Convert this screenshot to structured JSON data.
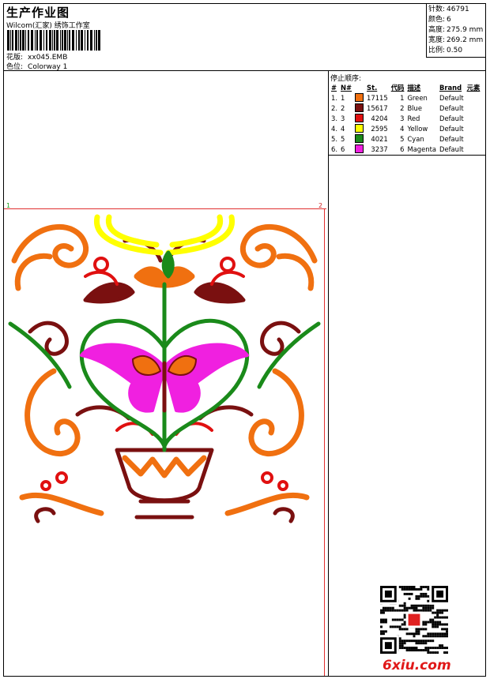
{
  "header": {
    "title": "生产作业图",
    "subtitle": "Wilcom(汇家) 绣饰工作室",
    "design_label": "花版:",
    "design_value": "xx045.EMB",
    "colorway_label": "色位:",
    "colorway_value": "Colorway 1"
  },
  "stats": {
    "stitches_label": "针数:",
    "stitches_value": "46791",
    "colors_label": "颜色:",
    "colors_value": "6",
    "height_label": "高度:",
    "height_value": "275.9 mm",
    "width_label": "宽度:",
    "width_value": "269.2 mm",
    "scale_label": "比例:",
    "scale_value": "0.50"
  },
  "rulers": {
    "left_number": "1",
    "right_number": "2"
  },
  "stop_sequence": {
    "title": "停止顺序:",
    "headers": [
      "#",
      "N#",
      "St.",
      "代码",
      "描述",
      "Brand",
      "元素"
    ],
    "rows": [
      {
        "idx": "1.",
        "n": "1",
        "color": "#f07010",
        "st": "17115",
        "code": "1",
        "desc": "Green",
        "brand": "Default"
      },
      {
        "idx": "2.",
        "n": "2",
        "color": "#7a1010",
        "st": "15617",
        "code": "2",
        "desc": "Blue",
        "brand": "Default"
      },
      {
        "idx": "3.",
        "n": "3",
        "color": "#e01010",
        "st": "4204",
        "code": "3",
        "desc": "Red",
        "brand": "Default"
      },
      {
        "idx": "4.",
        "n": "4",
        "color": "#ffff00",
        "st": "2595",
        "code": "4",
        "desc": "Yellow",
        "brand": "Default"
      },
      {
        "idx": "5.",
        "n": "5",
        "color": "#1a8a1a",
        "st": "4021",
        "code": "5",
        "desc": "Cyan",
        "brand": "Default"
      },
      {
        "idx": "6.",
        "n": "6",
        "color": "#f020e0",
        "st": "3237",
        "code": "6",
        "desc": "Magenta",
        "brand": "Default"
      }
    ]
  },
  "watermark": "6xiu.com",
  "colors": {
    "orange": "#f07010",
    "maroon": "#7a1010",
    "red": "#e01010",
    "yellow": "#ffff00",
    "green": "#1a8a1a",
    "magenta": "#f020e0"
  }
}
